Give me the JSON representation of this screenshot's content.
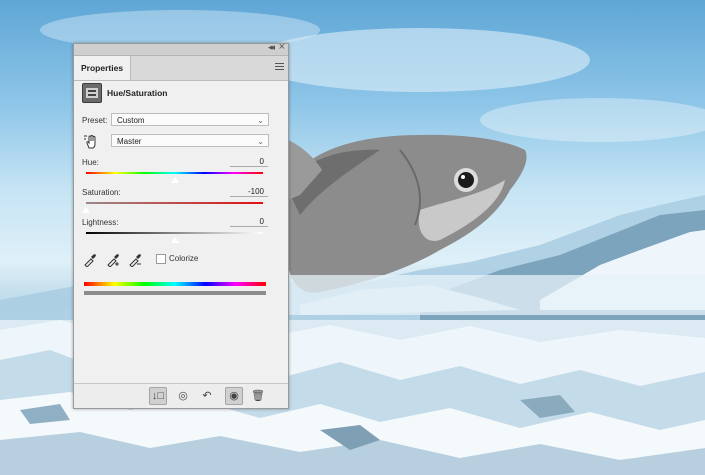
{
  "panel": {
    "title": "Properties",
    "adjustment": "Hue/Saturation",
    "icons": {
      "collapse": "double-chevron-icon",
      "close": "close-icon",
      "menu": "panel-menu-icon",
      "adjustment": "hue-saturation-layer-icon",
      "target": "on-image-adjust-hand-icon"
    }
  },
  "preset": {
    "label": "Preset:",
    "value": "Custom"
  },
  "channel": {
    "value": "Master"
  },
  "sliders": {
    "hue": {
      "label": "Hue:",
      "value": "0",
      "position": 0.5
    },
    "saturation": {
      "label": "Saturation:",
      "value": "-100",
      "position": 0.0
    },
    "lightness": {
      "label": "Lightness:",
      "value": "0",
      "position": 0.5
    }
  },
  "tools": {
    "eyedropper": "eyedropper-icon",
    "eyedropper_add": "eyedropper-plus-icon",
    "eyedropper_subtract": "eyedropper-minus-icon"
  },
  "colorize": {
    "label": "Colorize",
    "checked": false
  },
  "footer": {
    "buttons": [
      {
        "name": "clip-to-layer-icon",
        "glyph": "↓□",
        "active": true
      },
      {
        "name": "view-previous-state-icon",
        "glyph": "◎",
        "active": false
      },
      {
        "name": "reset-icon",
        "glyph": "↶",
        "active": false
      },
      {
        "name": "visibility-eye-icon",
        "glyph": "◉",
        "active": true
      },
      {
        "name": "trash-icon",
        "glyph": "🗑",
        "active": false
      }
    ]
  },
  "colors": {
    "panel_bg": "#f0f0f0",
    "sky": "#8ec6e8",
    "ice": "#eaf4fb",
    "fish": "#8a8a8a"
  }
}
